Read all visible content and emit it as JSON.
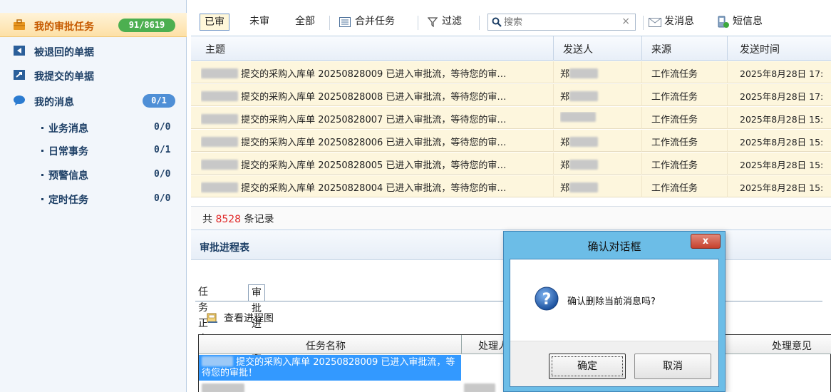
{
  "sidebar": {
    "items": [
      {
        "label": "我的审批任务",
        "badge": "91/8619",
        "icon": "briefcase-icon",
        "active": true
      },
      {
        "label": "被退回的单据",
        "icon": "return-doc-icon"
      },
      {
        "label": "我提交的单据",
        "icon": "submit-doc-icon"
      },
      {
        "label": "我的消息",
        "badge": "0/1",
        "icon": "chat-bubble-icon"
      }
    ],
    "sub_items": [
      {
        "label": "业务消息",
        "count": "0/0"
      },
      {
        "label": "日常事务",
        "count": "0/1"
      },
      {
        "label": "预警信息",
        "count": "0/0"
      },
      {
        "label": "定时任务",
        "count": "0/0"
      }
    ],
    "colors": {
      "active_badge": "#4caf50",
      "msg_badge": "#4f8fd6"
    }
  },
  "toolbar": {
    "filter_done": "已审",
    "filter_pending": "未审",
    "filter_all": "全部",
    "merge_tasks": "合并任务",
    "filter": "过滤",
    "search_placeholder": "搜索",
    "search_clear": "×",
    "send_message": "发消息",
    "sms": "短信息"
  },
  "grid": {
    "headers": {
      "subject": "主题",
      "sender": "发送人",
      "source": "来源",
      "send_time": "发送时间"
    },
    "rows": [
      {
        "subject": "提交的采购入库单 20250828009 已进入审批流，等待您的审…",
        "sender_prefix": "郑",
        "source": "工作流任务",
        "time": "2025年8月28日 17:"
      },
      {
        "subject": "提交的采购入库单 20250828008 已进入审批流，等待您的审…",
        "sender_prefix": "郑",
        "source": "工作流任务",
        "time": "2025年8月28日 17:"
      },
      {
        "subject": "提交的采购入库单 20250828007 已进入审批流，等待您的审…",
        "sender_prefix": "",
        "source": "工作流任务",
        "time": "2025年8月28日 15:"
      },
      {
        "subject": "提交的采购入库单 20250828006 已进入审批流，等待您的审…",
        "sender_prefix": "郑",
        "source": "工作流任务",
        "time": "2025年8月28日 15:"
      },
      {
        "subject": "提交的采购入库单 20250828005 已进入审批流，等待您的审…",
        "sender_prefix": "郑",
        "source": "工作流任务",
        "time": "2025年8月28日 15:"
      },
      {
        "subject": "提交的采购入库单 20250828004 已进入审批流，等待您的审…",
        "sender_prefix": "郑",
        "source": "工作流任务",
        "time": "2025年8月28日 15:"
      }
    ],
    "footer_prefix": "共",
    "footer_count": "8528",
    "footer_suffix": "条记录"
  },
  "lower": {
    "title": "审批进程表",
    "tabs": [
      "任务正文",
      "审批进程表"
    ],
    "view_flow": "查看进程图",
    "headers": {
      "task_name": "任务名称",
      "handler": "处理人",
      "opinion": "处理意见"
    },
    "selected_row": "提交的采购入库单 20250828009 已进入审批流，等待您的审批！"
  },
  "dialog": {
    "title": "确认对话框",
    "close": "x",
    "message": "确认删除当前消息吗?",
    "ok": "确定",
    "cancel": "取消",
    "icon": "question-icon"
  }
}
